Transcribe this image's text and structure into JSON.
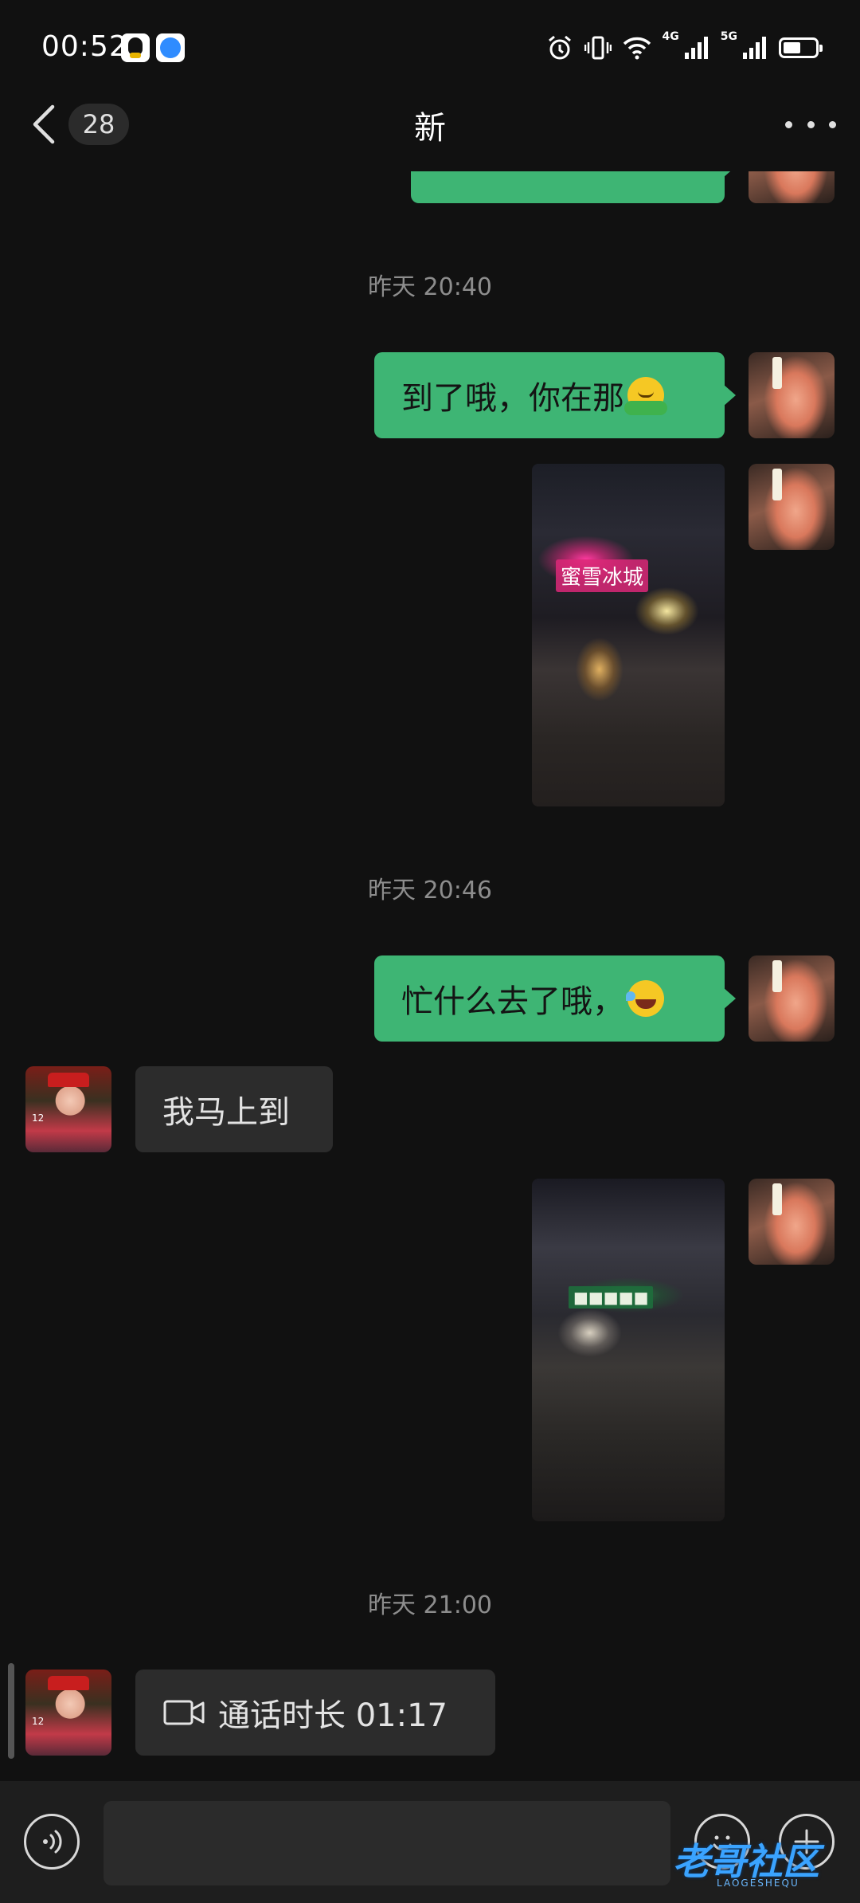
{
  "status_bar": {
    "time": "00:52",
    "network_1": "4G",
    "network_2": "5G",
    "battery_level": 0.55,
    "icons": [
      "qq-icon",
      "browser-icon",
      "alarm-icon",
      "vibrate-icon",
      "wifi-icon",
      "signal-icon",
      "signal-icon",
      "battery-icon"
    ]
  },
  "nav": {
    "unread_count": "28",
    "title": "新"
  },
  "messages": {
    "timestamp_1": "昨天 20:40",
    "msg_1_text": "到了哦，你在那",
    "timestamp_2": "昨天 20:46",
    "msg_3_text": "忙什么去了哦，",
    "msg_4_text": "我马上到",
    "timestamp_3": "昨天 21:00",
    "call_text": "通话时长 01:17",
    "photo_1_sign": "蜜雪冰城"
  },
  "input_bar": {
    "placeholder": ""
  },
  "watermark": {
    "text": "老哥社区",
    "sub": "LAOGESHEQU"
  },
  "colors": {
    "background": "#111111",
    "my_bubble": "#3eb574",
    "other_bubble": "#2c2c2c"
  }
}
